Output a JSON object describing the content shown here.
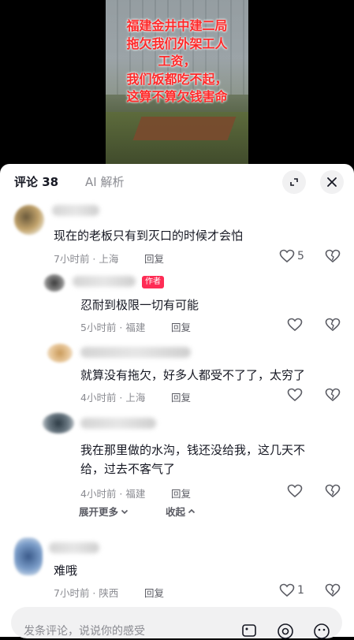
{
  "video": {
    "overlay_lines": [
      "福建金井中建二局",
      "拖欠我们外架工人",
      "工资，",
      "我们饭都吃不起，",
      "这算不算欠钱害命"
    ]
  },
  "tabs": {
    "comments_label": "评论 38",
    "ai_label": "AI 解析"
  },
  "comments": [
    {
      "text": "现在的老板只有到灭口的时候才会怕",
      "meta": "7小时前 · 上海",
      "reply_label": "回复",
      "likes": "5"
    },
    {
      "badge": "作者",
      "text": "忍耐到极限一切有可能",
      "meta": "5小时前 · 福建",
      "reply_label": "回复",
      "likes": ""
    },
    {
      "text": "就算没有拖欠，好多人都受不了了，太穷了",
      "meta": "4小时前 · 上海",
      "reply_label": "回复",
      "likes": ""
    },
    {
      "text_line1": "我在那里做的水沟，钱还没给我，这几天不",
      "text_line2": "给，过去不客气了",
      "meta": "4小时前 · 福建",
      "reply_label": "回复",
      "likes": ""
    },
    {
      "text": "难哦",
      "meta": "7小时前 · 陕西",
      "reply_label": "回复",
      "likes": "1"
    }
  ],
  "fold": {
    "expand_label": "展开更多",
    "collapse_label": "收起"
  },
  "input": {
    "placeholder": "发条评论，说说你的感受"
  },
  "colors": {
    "overlay_text": "#ff2a2a",
    "author_badge": "#fe2c55",
    "primary_text": "#161823",
    "secondary_text": "#8a8b91"
  },
  "icons": [
    "expand-icon",
    "close-icon",
    "heart-icon",
    "broken-heart-icon",
    "chevron-down-icon",
    "chevron-up-icon",
    "image-icon",
    "at-icon",
    "emoji-icon"
  ]
}
